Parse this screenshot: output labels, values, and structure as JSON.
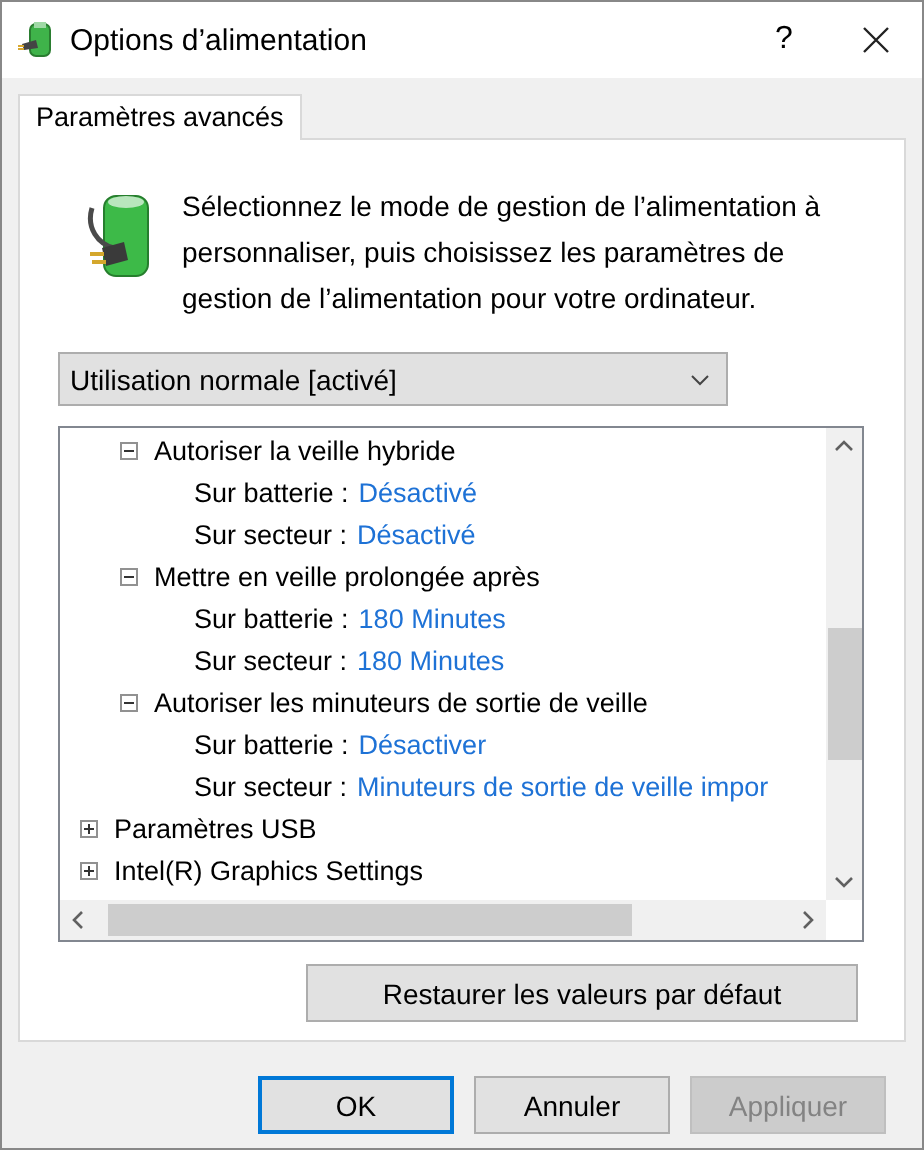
{
  "window": {
    "title": "Options d’alimentation",
    "help": "?"
  },
  "tabs": [
    {
      "label": "Paramètres avancés",
      "selected": true
    }
  ],
  "description": "Sélectionnez le mode de gestion de l’alimentation à personnaliser, puis choisissez les paramètres de gestion de l’alimentation pour votre ordinateur.",
  "plan_dropdown": {
    "value": "Utilisation normale [activé]"
  },
  "settings_tree": [
    {
      "children": [
        {
          "label": "Autoriser la veille hybride",
          "expanded": true,
          "children": [
            {
              "label": "Sur batterie :",
              "value": "Désactivé"
            },
            {
              "label": "Sur secteur :",
              "value": "Désactivé"
            }
          ]
        },
        {
          "label": "Mettre en veille prolongée après",
          "expanded": true,
          "children": [
            {
              "label": "Sur batterie :",
              "value": "180 Minutes"
            },
            {
              "label": "Sur secteur :",
              "value": "180 Minutes"
            }
          ]
        },
        {
          "label": "Autoriser les minuteurs de sortie de veille",
          "expanded": true,
          "children": [
            {
              "label": "Sur batterie :",
              "value": "Désactiver"
            },
            {
              "label": "Sur secteur :",
              "value": "Minuteurs de sortie de veille impor"
            }
          ]
        }
      ]
    },
    {
      "label": "Paramètres USB",
      "expanded": false
    },
    {
      "label": "Intel(R) Graphics Settings",
      "expanded": false
    }
  ],
  "restore_button": "Restaurer les valeurs par défaut",
  "buttons": [
    {
      "label": "OK",
      "disabled": false,
      "default": true
    },
    {
      "label": "Annuler",
      "disabled": false,
      "default": false
    },
    {
      "label": "Appliquer",
      "disabled": true,
      "default": false
    }
  ]
}
